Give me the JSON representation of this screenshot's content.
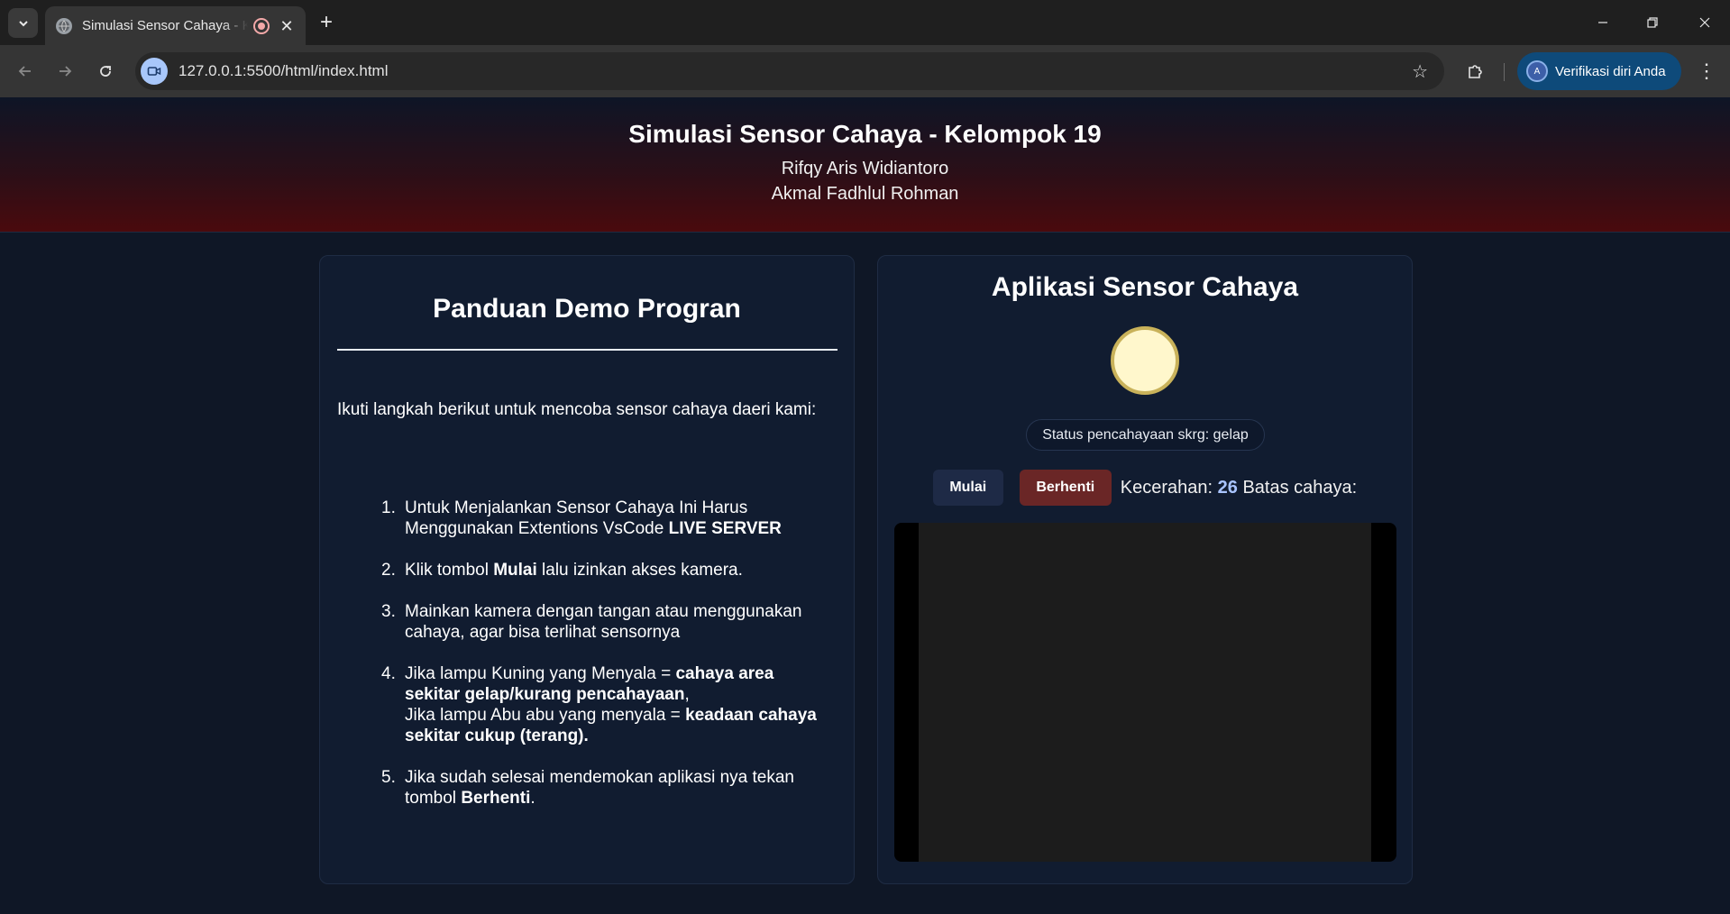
{
  "browser": {
    "tab_title": "Simulasi Sensor Cahaya - Kelompok 19",
    "url": "127.0.0.1:5500/html/index.html",
    "profile_label": "Verifikasi diri Anda",
    "profile_initial": "A",
    "accent": "#0e4a7a"
  },
  "header": {
    "title": "Simulasi Sensor Cahaya - Kelompok 19",
    "members": [
      "Rifqy Aris Widiantoro",
      "Akmal Fadhlul Rohman"
    ]
  },
  "guide": {
    "title": "Panduan Demo Progran",
    "intro": "Ikuti langkah berikut untuk mencoba sensor cahaya daeri kami:",
    "steps": [
      {
        "num": "1.",
        "text_a": "Untuk Menjalankan Sensor Cahaya Ini Harus Menggunakan Extentions VsCode ",
        "bold_a": "LIVE SERVER"
      },
      {
        "num": "2.",
        "text_a": "Klik tombol ",
        "bold_a": "Mulai",
        "text_b": " lalu izinkan akses kamera."
      },
      {
        "num": "3.",
        "text_a": "Mainkan kamera dengan tangan atau menggunakan cahaya, agar bisa terlihat sensornya"
      },
      {
        "num": "4.",
        "text_a": "Jika lampu Kuning yang Menyala = ",
        "bold_a": "cahaya area sekitar gelap/kurang pencahayaan",
        "text_b": ",",
        "text_c": "Jika lampu Abu abu yang menyala = ",
        "bold_b": "keadaan cahaya sekitar cukup (terang)."
      },
      {
        "num": "5.",
        "text_a": "Jika sudah selesai mendemokan aplikasi nya tekan tombol ",
        "bold_a": "Berhenti",
        "text_b": "."
      }
    ]
  },
  "app": {
    "title": "Aplikasi Sensor Cahaya",
    "lamp_color": "#fff7cc",
    "status": "Status pencahayaan skrg: gelap",
    "start_label": "Mulai",
    "stop_label": "Berhenti",
    "brightness_label": "Kecerahan:",
    "brightness_value": "26",
    "threshold_label": "Batas cahaya:"
  }
}
